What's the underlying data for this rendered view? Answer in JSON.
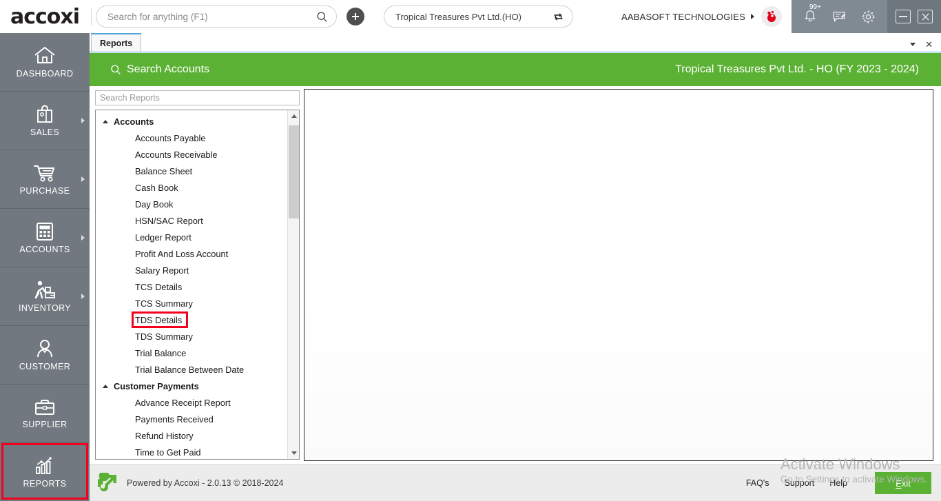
{
  "topbar": {
    "logo_text": "accoxi",
    "logo_icon": "leaf-icon",
    "search_placeholder": "Search for anything (F1)",
    "search_value": "",
    "search_icon": "search-icon",
    "add_icon": "plus-icon",
    "company_value": "Tropical Treasures Pvt Ltd.(HO)",
    "company_switch_icon": "refresh-switch-icon",
    "org_name": "AABASOFT TECHNOLOGIES",
    "org_caret_icon": "chevron-right-icon",
    "avatar_icon": "user-avatar-icon",
    "notification_icon": "bell-icon",
    "notification_badge": "99+",
    "feedback_icon": "message-edit-icon",
    "settings_icon": "gear-icon",
    "minimize_icon": "minimize-icon",
    "close_icon": "close-icon"
  },
  "sidebar": {
    "items": [
      {
        "label": "DASHBOARD",
        "icon": "home-icon",
        "has_arrow": false,
        "highlighted": false
      },
      {
        "label": "SALES",
        "icon": "shopping-bag-icon",
        "has_arrow": true,
        "highlighted": false
      },
      {
        "label": "PURCHASE",
        "icon": "shopping-cart-icon",
        "has_arrow": true,
        "highlighted": false
      },
      {
        "label": "ACCOUNTS",
        "icon": "calculator-icon",
        "has_arrow": true,
        "highlighted": false
      },
      {
        "label": "INVENTORY",
        "icon": "warehouse-worker-icon",
        "has_arrow": true,
        "highlighted": false
      },
      {
        "label": "CUSTOMER",
        "icon": "person-icon",
        "has_arrow": false,
        "highlighted": false
      },
      {
        "label": "SUPPLIER",
        "icon": "briefcase-icon",
        "has_arrow": false,
        "highlighted": false
      },
      {
        "label": "REPORTS",
        "icon": "bar-chart-icon",
        "has_arrow": false,
        "highlighted": true
      }
    ]
  },
  "tabstrip": {
    "tabs": [
      {
        "label": "Reports"
      }
    ],
    "dropdown_icon": "chevron-down-icon",
    "close_icon": "close-icon"
  },
  "greenbar": {
    "search_accounts_label": "Search Accounts",
    "search_icon": "search-icon",
    "company_fy_label": "Tropical Treasures Pvt Ltd. - HO (FY 2023 - 2024)",
    "color": "#5BB134"
  },
  "reports": {
    "search_placeholder": "Search Reports",
    "search_value": "",
    "groups": [
      {
        "title": "Accounts",
        "collapse_icon": "chevron-up-icon",
        "items": [
          "Accounts Payable",
          "Accounts Receivable",
          "Balance Sheet",
          "Cash Book",
          "Day Book",
          "HSN/SAC Report",
          "Ledger Report",
          "Profit And Loss Account",
          "Salary Report",
          "TCS Details",
          "TCS Summary",
          "TDS Details",
          "TDS Summary",
          "Trial Balance",
          "Trial Balance Between Date"
        ],
        "highlighted_item": "TDS Details"
      },
      {
        "title": "Customer Payments",
        "collapse_icon": "chevron-up-icon",
        "items": [
          "Advance Receipt Report",
          "Payments Received",
          "Refund History",
          "Time to Get Paid"
        ],
        "highlighted_item": ""
      }
    ],
    "scroll_up_icon": "triangle-up-icon",
    "scroll_down_icon": "triangle-down-icon"
  },
  "watermark": {
    "line1": "Activate Windows",
    "line2": "Go to Settings to activate Windows."
  },
  "footer": {
    "logo_icon": "accoxi-arrow-logo",
    "powered_by": "Powered by Accoxi - 2.0.13 © 2018-2024",
    "links": [
      "FAQ's",
      "Support",
      "Help"
    ],
    "exit_label_prefix": "E",
    "exit_label_rest": "xit"
  },
  "annotations": {
    "highlight_color": "#f4001e"
  }
}
